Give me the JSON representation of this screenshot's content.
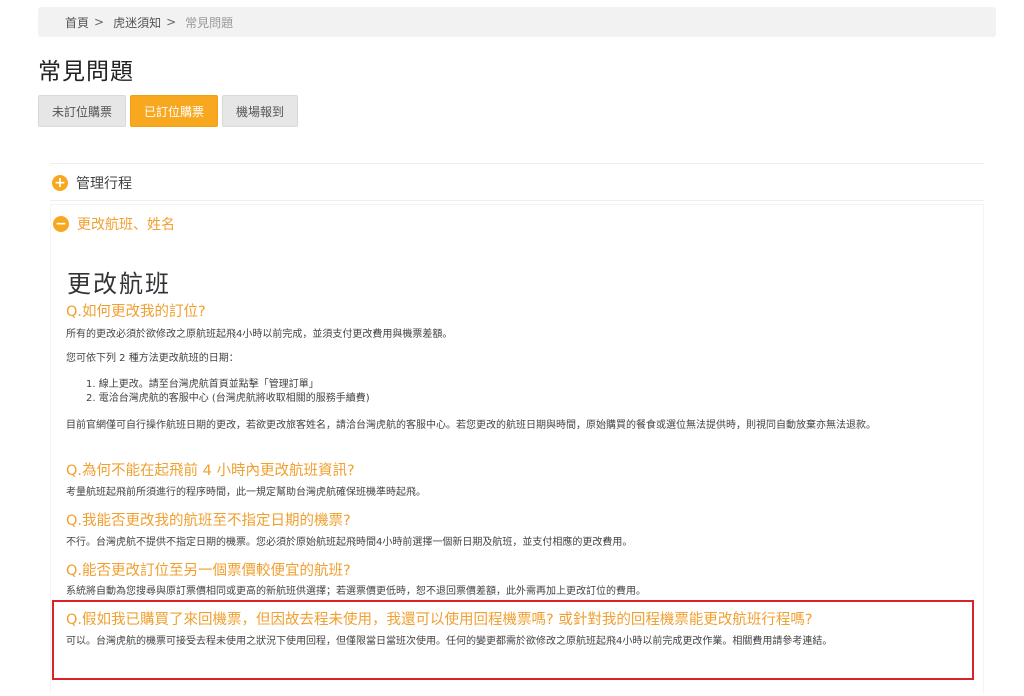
{
  "breadcrumb": {
    "items": [
      "首頁",
      "虎迷須知"
    ],
    "separator": ">",
    "current": "常見問題"
  },
  "page_title": "常見問題",
  "tabs": [
    {
      "label": "未訂位購票",
      "active": false
    },
    {
      "label": "已訂位購票",
      "active": true
    },
    {
      "label": "機場報到",
      "active": false
    }
  ],
  "accordion": [
    {
      "title": "管理行程",
      "expanded": false,
      "icon": "plus-icon"
    },
    {
      "title": "更改航班、姓名",
      "expanded": true,
      "icon": "minus-icon"
    }
  ],
  "content": {
    "section_title": "更改航班",
    "q1": "Q.如何更改我的訂位?",
    "q1_p1": "所有的更改必須於欲修改之原航班起飛4小時以前完成，並須支付更改費用與機票差額。",
    "q1_p2": "您可依下列 2 種方法更改航班的日期：",
    "q1_list": [
      "1. 線上更改。請至台灣虎航首頁並點擊「管理訂單」",
      "2. 電洽台灣虎航的客服中心 (台灣虎航將收取相關的服務手續費)"
    ],
    "q1_p3": "目前官網僅可自行操作航班日期的更改，若欲更改旅客姓名，請洽台灣虎航的客服中心。若您更改的航班日期與時間，原始購買的餐食或選位無法提供時，則視同自動放棄亦無法退款。",
    "q2": "Q.為何不能在起飛前 4 小時內更改航班資訊?",
    "q2_p": "考量航班起飛前所須進行的程序時間，此一規定幫助台灣虎航確保班機準時起飛。",
    "q3": "Q.我能否更改我的航班至不指定日期的機票?",
    "q3_p": "不行。台灣虎航不提供不指定日期的機票。您必須於原始航班起飛時間4小時前選擇一個新日期及航班，並支付相應的更改費用。",
    "q4": "Q.能否更改訂位至另一個票價較便宜的航班?",
    "q4_p": "系統將自動為您搜尋與原訂票價相同或更高的新航班供選擇；若選票價更低時，恕不退回票價差額，此外需再加上更改訂位的費用。",
    "q5": "Q.假如我已購買了來回機票，但因故去程未使用，我還可以使用回程機票嗎? 或針對我的回程機票能更改航班行程嗎?",
    "q5_p": "可以。台灣虎航的機票可接受去程未使用之狀況下使用回程，但僅限當日當班次使用。任何的變更都需於欲修改之原航班起飛4小時以前完成更改作業。相關費用請參考連結。"
  },
  "colors": {
    "accent": "#f7a81f",
    "highlight_border": "#d8232a"
  }
}
